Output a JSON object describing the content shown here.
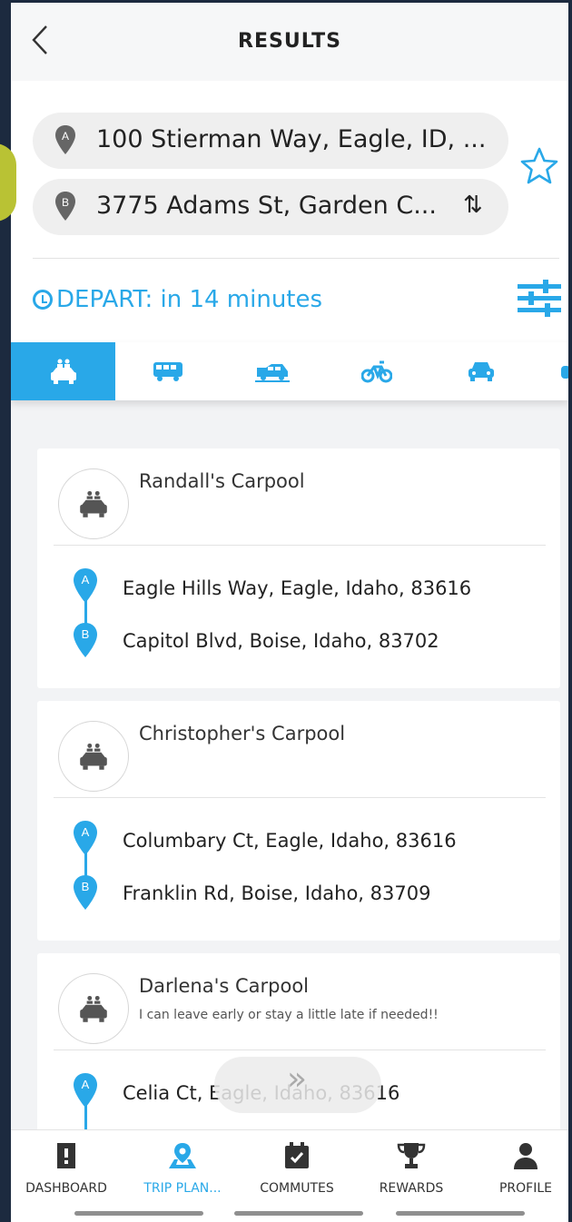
{
  "header": {
    "back_icon": "chevron-left-icon",
    "title": "RESULTS"
  },
  "search": {
    "origin": "100 Stierman Way, Eagle, ID, ...",
    "origin_marker": "A",
    "destination": "3775 Adams St, Garden C...",
    "destination_marker": "B",
    "swap_icon": "⇅",
    "favorite_icon": "star-outline-icon",
    "depart_label": "DEPART: in 14 minutes",
    "filter_icon": "sliders-icon"
  },
  "modes": [
    {
      "icon": "carpool-icon",
      "active": true
    },
    {
      "icon": "bus-icon",
      "active": false
    },
    {
      "icon": "vanpool-icon",
      "active": false
    },
    {
      "icon": "bicycle-icon",
      "active": false
    },
    {
      "icon": "car-icon",
      "active": false
    }
  ],
  "results": [
    {
      "name": "Randall's Carpool",
      "note": "",
      "from": "Eagle Hills Way, Eagle, Idaho, 83616",
      "to": "Capitol Blvd, Boise, Idaho, 83702"
    },
    {
      "name": "Christopher's Carpool",
      "note": "",
      "from": "Columbary Ct, Eagle, Idaho, 83616",
      "to": "Franklin Rd, Boise, Idaho, 83709"
    },
    {
      "name": "Darlena's Carpool",
      "note": "I can leave early or stay a little late if needed!!",
      "from": "Celia Ct, Eagle, Idaho, 83616",
      "to": ""
    }
  ],
  "scroll_hint": "»",
  "nav": [
    {
      "label": "DASHBOARD",
      "icon": "building-icon",
      "active": false
    },
    {
      "label": "TRIP PLAN...",
      "icon": "map-pin-icon",
      "active": true
    },
    {
      "label": "COMMUTES",
      "icon": "calendar-check-icon",
      "active": false
    },
    {
      "label": "REWARDS",
      "icon": "trophy-icon",
      "active": false
    },
    {
      "label": "PROFILE",
      "icon": "person-icon",
      "active": false
    }
  ],
  "colors": {
    "accent": "#29a8e8",
    "background": "#f2f3f5",
    "text": "#222222"
  }
}
